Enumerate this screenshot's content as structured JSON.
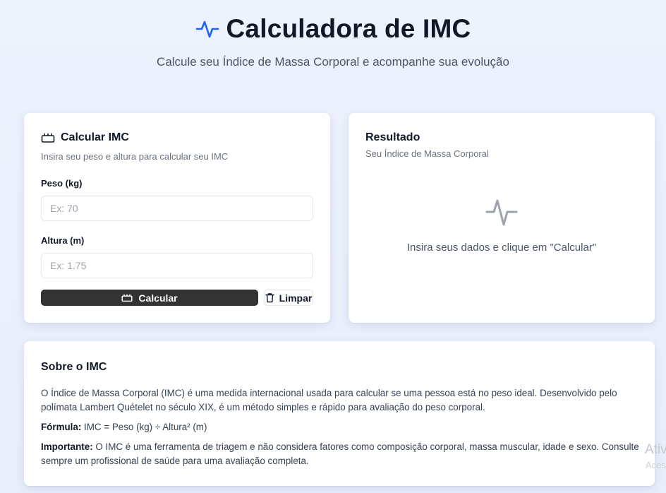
{
  "header": {
    "title": "Calculadora de IMC",
    "subtitle": "Calcule seu Índice de Massa Corporal e acompanhe sua evolução",
    "icon": "activity-icon"
  },
  "calc_card": {
    "title": "Calcular IMC",
    "icon": "scale-icon",
    "description": "Insira seu peso e altura para calcular seu IMC",
    "weight_label": "Peso (kg)",
    "weight_placeholder": "Ex: 70",
    "weight_value": "",
    "height_label": "Altura (m)",
    "height_placeholder": "Ex: 1.75",
    "height_value": "",
    "calculate_label": "Calcular",
    "clear_label": "Limpar"
  },
  "result_card": {
    "title": "Resultado",
    "description": "Seu Índice de Massa Corporal",
    "empty_text": "Insira seus dados e clique em \"Calcular\"",
    "icon": "activity-icon"
  },
  "about_card": {
    "title": "Sobre o IMC",
    "paragraph": "O Índice de Massa Corporal (IMC) é uma medida internacional usada para calcular se uma pessoa está no peso ideal. Desenvolvido pelo polímata Lambert Quételet no século XIX, é um método simples e rápido para avaliação do peso corporal.",
    "formula_label": "Fórmula:",
    "formula_text": "IMC = Peso (kg) ÷ Altura² (m)",
    "important_label": "Importante:",
    "important_text": "O IMC é uma ferramenta de triagem e não considera fatores como composição corporal, massa muscular, idade e sexo. Consulte sempre um profissional de saúde para uma avaliação completa."
  },
  "watermark": {
    "line1": "Ativ",
    "line2": "Aces"
  },
  "colors": {
    "accent": "#2563eb",
    "primary_button": "#333333",
    "background": "#edf2fd"
  }
}
